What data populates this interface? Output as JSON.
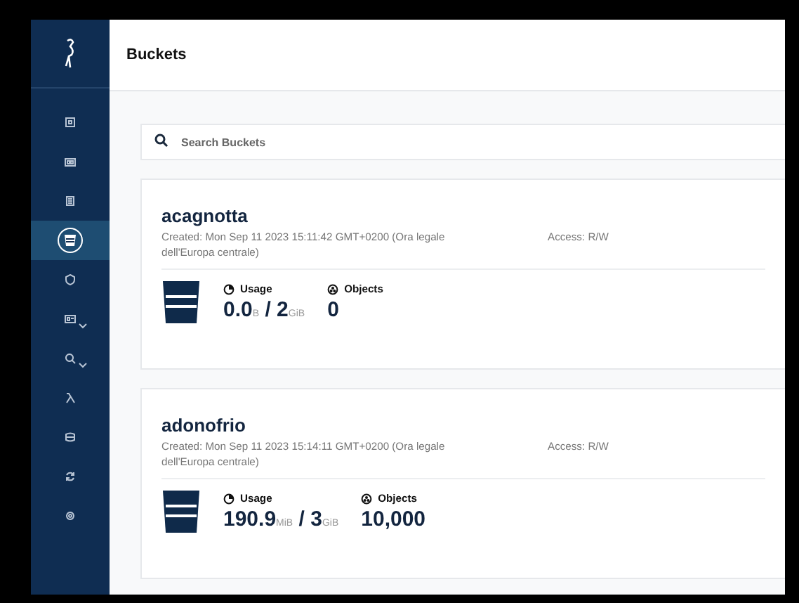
{
  "page": {
    "title": "Buckets"
  },
  "sidebar": {
    "items": [
      {
        "selected": false,
        "has_submenu": false
      },
      {
        "selected": false,
        "has_submenu": false
      },
      {
        "selected": false,
        "has_submenu": false
      },
      {
        "selected": true,
        "has_submenu": false
      },
      {
        "selected": false,
        "has_submenu": false
      },
      {
        "selected": false,
        "has_submenu": true
      },
      {
        "selected": false,
        "has_submenu": true
      },
      {
        "selected": false,
        "has_submenu": false
      },
      {
        "selected": false,
        "has_submenu": false
      },
      {
        "selected": false,
        "has_submenu": false
      },
      {
        "selected": false,
        "has_submenu": false
      }
    ]
  },
  "search": {
    "placeholder": "Search Buckets"
  },
  "buckets": [
    {
      "name": "acagnotta",
      "created": "Created: Mon Sep 11 2023 15:11:42 GMT+0200 (Ora legale dell'Europa centrale)",
      "access": "Access: R/W",
      "usage_label": "Usage",
      "used": "0.0",
      "used_unit": "B",
      "separator": "/",
      "total": "2",
      "total_unit": "GiB",
      "objects_label": "Objects",
      "objects": "0"
    },
    {
      "name": "adonofrio",
      "created": "Created: Mon Sep 11 2023 15:14:11 GMT+0200 (Ora legale dell'Europa centrale)",
      "access": "Access: R/W",
      "usage_label": "Usage",
      "used": "190.9",
      "used_unit": "MiB",
      "separator": "/",
      "total": "3",
      "total_unit": "GiB",
      "objects_label": "Objects",
      "objects": "10,000"
    }
  ]
}
